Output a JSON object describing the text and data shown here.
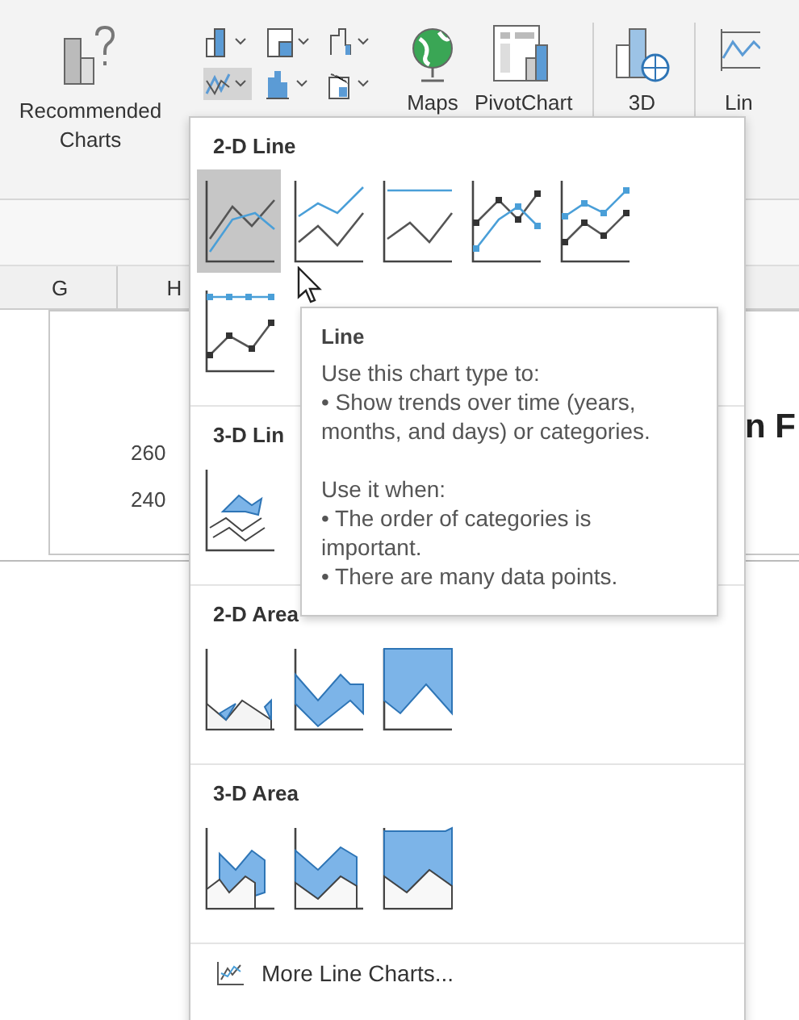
{
  "ribbon": {
    "recommended": {
      "label": "Recommended Charts"
    },
    "buttons": [
      {
        "kind": "maps",
        "label": "Maps"
      },
      {
        "kind": "pivot",
        "label": "PivotChart"
      },
      {
        "kind": "map3d",
        "label": "3D"
      },
      {
        "kind": "sparkline",
        "label": "Lin"
      }
    ]
  },
  "sheet": {
    "columns": [
      "G",
      "H"
    ],
    "axis_labels": [
      "260",
      "240"
    ],
    "chart_title": "n F"
  },
  "dropdown": {
    "sections": [
      {
        "title": "2-D Line",
        "items": [
          {
            "kind": "line",
            "selected": true
          },
          {
            "kind": "stacked",
            "selected": false
          },
          {
            "kind": "percent",
            "selected": false
          },
          {
            "kind": "markers",
            "selected": false
          },
          {
            "kind": "stackedmarkers",
            "selected": false
          },
          {
            "kind": "percentmarkers",
            "selected": false
          }
        ]
      },
      {
        "title": "3-D Lin",
        "items": [
          {
            "kind": "line3d",
            "selected": false
          }
        ]
      },
      {
        "title": "2-D Area",
        "items": [
          {
            "kind": "area",
            "selected": false
          },
          {
            "kind": "stackedarea",
            "selected": false
          },
          {
            "kind": "percentarea",
            "selected": false
          }
        ]
      },
      {
        "title": "3-D Area",
        "items": [
          {
            "kind": "area3d",
            "selected": false
          },
          {
            "kind": "stackedarea3d",
            "selected": false
          },
          {
            "kind": "percentarea3d",
            "selected": false
          }
        ]
      }
    ],
    "more_link": "More Line Charts..."
  },
  "tooltip": {
    "title": "Line",
    "groups": [
      {
        "lines": [
          "Use this chart type to:",
          "• Show trends over time (years, months, and days) or categories."
        ]
      },
      {
        "lines": [
          "Use it when:",
          "• The order of categories is important.",
          "• There are many data points."
        ]
      }
    ]
  }
}
